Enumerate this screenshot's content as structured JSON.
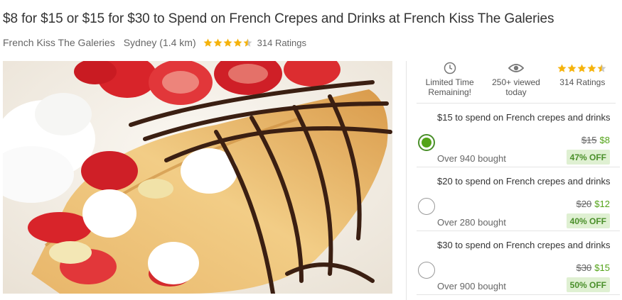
{
  "deal": {
    "title": "$8 for $15 or $15 for $30 to Spend on French Crepes and Drinks at French Kiss The Galeries",
    "merchant": "French Kiss The Galeries",
    "location": "Sydney (1.4 km)",
    "rating_value": 4.5,
    "ratings_text": "314 Ratings"
  },
  "hero": {
    "alt": "Crepe with strawberries, bananas, whipped cream and chocolate drizzle"
  },
  "stats": {
    "time": {
      "icon": "clock-icon",
      "line1": "Limited Time",
      "line2": "Remaining!"
    },
    "views": {
      "icon": "eye-icon",
      "line1": "250+ viewed",
      "line2": "today"
    },
    "rating": {
      "icon": "star-icon",
      "line1": "314 Ratings"
    }
  },
  "options": [
    {
      "title": "$15 to spend on French crepes and drinks",
      "old_price": "$15",
      "new_price": "$8",
      "bought": "Over 940 bought",
      "discount": "47% OFF",
      "selected": true
    },
    {
      "title": "$20 to spend on French crepes and drinks",
      "old_price": "$20",
      "new_price": "$12",
      "bought": "Over 280 bought",
      "discount": "40% OFF",
      "selected": false
    },
    {
      "title": "$30 to spend on French crepes and drinks",
      "old_price": "$30",
      "new_price": "$15",
      "bought": "Over 900 bought",
      "discount": "50% OFF",
      "selected": false
    }
  ],
  "colors": {
    "accent_green": "#53a318",
    "badge_bg": "#dff0d2",
    "star": "#f5b30c"
  }
}
